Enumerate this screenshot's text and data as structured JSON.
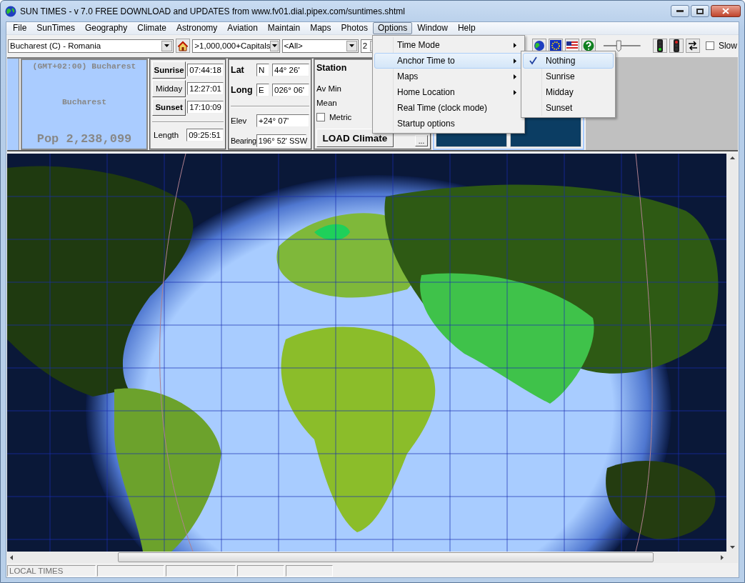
{
  "window": {
    "title": "SUN TIMES  -  v 7.0 FREE DOWNLOAD and UPDATES from www.fv01.dial.pipex.com/suntimes.shtml"
  },
  "menu": [
    {
      "label": "File",
      "selected": false
    },
    {
      "label": "SunTimes",
      "selected": false
    },
    {
      "label": "Geography",
      "selected": false
    },
    {
      "label": "Climate",
      "selected": false
    },
    {
      "label": "Astronomy",
      "selected": false
    },
    {
      "label": "Aviation",
      "selected": false
    },
    {
      "label": "Maintain",
      "selected": false
    },
    {
      "label": "Maps",
      "selected": false
    },
    {
      "label": "Photos",
      "selected": false
    },
    {
      "label": "Options",
      "selected": true
    },
    {
      "label": "Window",
      "selected": false
    },
    {
      "label": "Help",
      "selected": false
    }
  ],
  "toolbar": {
    "location": "Bucharest (C) - Romania",
    "population_filter": ">1,000,000+Capitals",
    "region_filter": "<All>",
    "combo_4": "2",
    "speed_slider": {
      "level": 0.4
    },
    "slow": {
      "label": "Slow",
      "checked": false
    }
  },
  "info": {
    "timezone": "(GMT+02:00) Bucharest",
    "city": "Bucharest",
    "population": "Pop 2,238,099",
    "times": [
      {
        "label": "Sunrise",
        "value": "07:44:18",
        "bold": true
      },
      {
        "label": "Midday",
        "value": "12:27:01",
        "bold": false
      },
      {
        "label": "Sunset",
        "value": "17:10:09",
        "bold": true
      }
    ],
    "length": {
      "label": "Length",
      "value": "09:25:51"
    },
    "lat": {
      "label": "Lat",
      "hemisphere": "N",
      "value": "44° 26'"
    },
    "long": {
      "label": "Long",
      "hemisphere": "E",
      "value": "026° 06'"
    },
    "elev": {
      "label": "Elev",
      "value": "+24° 07'"
    },
    "bearing": {
      "label": "Bearing",
      "value": "196° 52' SSW"
    },
    "climate": {
      "station": "Station",
      "av_min": "Av Min",
      "mean": "Mean",
      "metric": {
        "label": "Metric",
        "checked": false
      },
      "load_button": "LOAD Climate",
      "more_button": "..."
    }
  },
  "options_menu": [
    {
      "label": "Time Mode",
      "submenu": true,
      "selected": false
    },
    {
      "label": "Anchor Time to",
      "submenu": true,
      "selected": true
    },
    {
      "label": "Maps",
      "submenu": true,
      "selected": false
    },
    {
      "label": "Home Location",
      "submenu": true,
      "selected": false
    },
    {
      "label": "Real Time (clock mode)",
      "submenu": false,
      "selected": false
    },
    {
      "label": "Startup options",
      "submenu": false,
      "selected": false
    }
  ],
  "anchor_submenu": [
    {
      "label": "Nothing",
      "checked": true,
      "selected": true
    },
    {
      "label": "Sunrise",
      "checked": false,
      "selected": false
    },
    {
      "label": "Midday",
      "checked": false,
      "selected": false
    },
    {
      "label": "Sunset",
      "checked": false,
      "selected": false
    }
  ],
  "status_bar": {
    "text": "LOCAL TIMES"
  }
}
